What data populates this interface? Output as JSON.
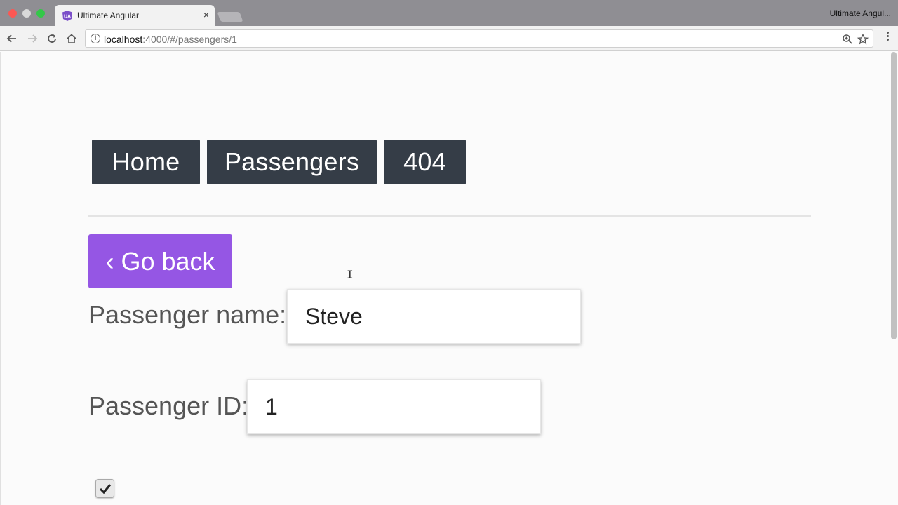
{
  "browser": {
    "tab_title": "Ultimate Angular",
    "tab_close": "×",
    "profile_name": "Ultimate Angul...",
    "url_host": "localhost",
    "url_rest": ":4000/#/passengers/1"
  },
  "nav": {
    "home": "Home",
    "passengers": "Passengers",
    "not_found": "404"
  },
  "page": {
    "back_label": "‹ Go back",
    "name_label": "Passenger name:",
    "name_value": "Steve",
    "id_label": "Passenger ID:",
    "id_value": "1",
    "checkbox_checked": true
  },
  "colors": {
    "nav_bg": "#353d47",
    "back_bg": "#9556e4"
  }
}
